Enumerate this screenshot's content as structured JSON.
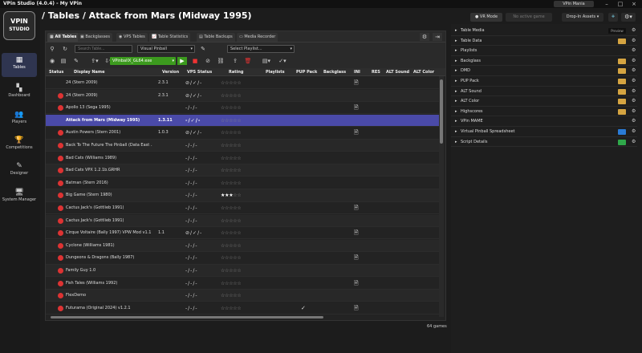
{
  "app_title": "VPin Studio (4.0.4) - My VPin",
  "page_title": "/ Tables / Attack from Mars (Midway 1995)",
  "topbar": {
    "user": "VPin Mania",
    "vr_mode": "VR Mode",
    "active_game": "No active game",
    "dropin": "Drop-In Assets"
  },
  "logo": {
    "line1": "VPIN",
    "line2": "STUDIO"
  },
  "nav": [
    {
      "label": "Tables",
      "icon": "▦"
    },
    {
      "label": "Dashboard",
      "icon": "▚"
    },
    {
      "label": "Players",
      "icon": "👥"
    },
    {
      "label": "Competitions",
      "icon": "🏆"
    },
    {
      "label": "Designer",
      "icon": "✎"
    },
    {
      "label": "System Manager",
      "icon": "🖥"
    }
  ],
  "tabs": [
    "All Tables",
    "Backglasses",
    "VPS Tables",
    "Table Statistics",
    "Table Backups",
    "Media Recorder"
  ],
  "toolbar": {
    "search_placeholder": "Search Table...",
    "emulator": "Visual Pinball",
    "playlist_placeholder": "Select Playlist...",
    "exe": "VPinballX_GL64.exe"
  },
  "columns": [
    "Status",
    "Display Name",
    "Version",
    "VPS Status",
    "Rating",
    "Playlists",
    "PUP Pack",
    "Backglass",
    "INI",
    "RES",
    "ALT Sound",
    "ALT Color"
  ],
  "rows": [
    {
      "name": "24 (Stern 2009)",
      "version": "2.3.1",
      "status": "",
      "vps": "⊘/✓/-",
      "rating": 0,
      "ini": true,
      "pup": false,
      "selected": false
    },
    {
      "name": "24 (Stern 2009)",
      "version": "2.3.1",
      "status": "red",
      "vps": "⊘/✓/-",
      "rating": 0,
      "ini": false,
      "pup": false,
      "selected": false
    },
    {
      "name": "Apollo 13 (Sega 1995)",
      "version": "",
      "status": "red",
      "vps": "-/-/-",
      "rating": 0,
      "ini": true,
      "pup": false,
      "selected": false
    },
    {
      "name": "Attack from Mars (Midway 1995)",
      "version": "1.3.11",
      "status": "",
      "vps": "-/✓/-",
      "rating": 0,
      "ini": false,
      "pup": false,
      "selected": true
    },
    {
      "name": "Austin Powers (Stern 2001)",
      "version": "1.0.3",
      "status": "red",
      "vps": "⊘/✓/-",
      "rating": 0,
      "ini": true,
      "pup": false,
      "selected": false
    },
    {
      "name": "Back To The Future   The Pinball (Data East ...",
      "version": "",
      "status": "red",
      "vps": "-/-/-",
      "rating": 0,
      "ini": false,
      "pup": false,
      "selected": false
    },
    {
      "name": "Bad Cats (Williams 1989)",
      "version": "",
      "status": "red",
      "vps": "-/-/-",
      "rating": 0,
      "ini": false,
      "pup": false,
      "selected": false
    },
    {
      "name": "Bad Cats VPX 1.2.1b.GRHR",
      "version": "",
      "status": "red",
      "vps": "-/-/-",
      "rating": 0,
      "ini": false,
      "pup": false,
      "selected": false
    },
    {
      "name": "Batman (Stern 2016)",
      "version": "",
      "status": "red",
      "vps": "-/-/-",
      "rating": 0,
      "ini": false,
      "pup": false,
      "selected": false
    },
    {
      "name": "Big Game (Stern 1980)",
      "version": "",
      "status": "red",
      "vps": "-/-/-",
      "rating": 3,
      "ini": false,
      "pup": false,
      "selected": false
    },
    {
      "name": "Cactus Jack's (Gottlieb 1991)",
      "version": "",
      "status": "red",
      "vps": "-/-/-",
      "rating": 0,
      "ini": true,
      "pup": false,
      "selected": false
    },
    {
      "name": "Cactus Jack's (Gottlieb 1991)",
      "version": "",
      "status": "red",
      "vps": "-/-/-",
      "rating": 0,
      "ini": false,
      "pup": false,
      "selected": false
    },
    {
      "name": "Cirque Voltaire (Bally 1997) VPW Mod v1.1",
      "version": "1.1",
      "status": "red",
      "vps": "⊘/✓/-",
      "rating": 0,
      "ini": true,
      "pup": false,
      "selected": false
    },
    {
      "name": "Cyclone (Williams 1981)",
      "version": "",
      "status": "red",
      "vps": "-/-/-",
      "rating": 0,
      "ini": false,
      "pup": false,
      "selected": false
    },
    {
      "name": "Dungeons & Dragons (Bally 1987)",
      "version": "",
      "status": "red",
      "vps": "-/-/-",
      "rating": 0,
      "ini": true,
      "pup": false,
      "selected": false
    },
    {
      "name": "Family Guy 1.0",
      "version": "",
      "status": "red",
      "vps": "-/-/-",
      "rating": 0,
      "ini": false,
      "pup": false,
      "selected": false
    },
    {
      "name": "Fish Tales (Williams 1992)",
      "version": "",
      "status": "red",
      "vps": "-/-/-",
      "rating": 0,
      "ini": true,
      "pup": false,
      "selected": false
    },
    {
      "name": "FlexDemo",
      "version": "",
      "status": "red",
      "vps": "-/-/-",
      "rating": 0,
      "ini": false,
      "pup": false,
      "selected": false
    },
    {
      "name": "Futurama (Original 2024) v1.2.1",
      "version": "",
      "status": "red",
      "vps": "-/-/-",
      "rating": 0,
      "ini": true,
      "pup": true,
      "selected": false
    }
  ],
  "game_count": "64 games",
  "right_sections": [
    {
      "label": "Table Media",
      "extra": "preview"
    },
    {
      "label": "Table Data",
      "extra": "folder"
    },
    {
      "label": "Playlists",
      "extra": ""
    },
    {
      "label": "Backglass",
      "extra": "folder"
    },
    {
      "label": "DMD",
      "extra": "folder"
    },
    {
      "label": "PUP Pack",
      "extra": "folder"
    },
    {
      "label": "ALT Sound",
      "extra": "folder"
    },
    {
      "label": "ALT Color",
      "extra": "folder"
    },
    {
      "label": "Highscores",
      "extra": "folder"
    },
    {
      "label": "VPin MAME",
      "extra": ""
    },
    {
      "label": "Virtual Pinball Spreadsheet",
      "extra": "blue"
    },
    {
      "label": "Script Details",
      "extra": "green"
    }
  ],
  "preview_label": "Preview",
  "colors": {
    "accent": "#4a4aa8",
    "danger": "#dd3333",
    "run": "#3c9a1e",
    "folder": "#d5a441"
  }
}
